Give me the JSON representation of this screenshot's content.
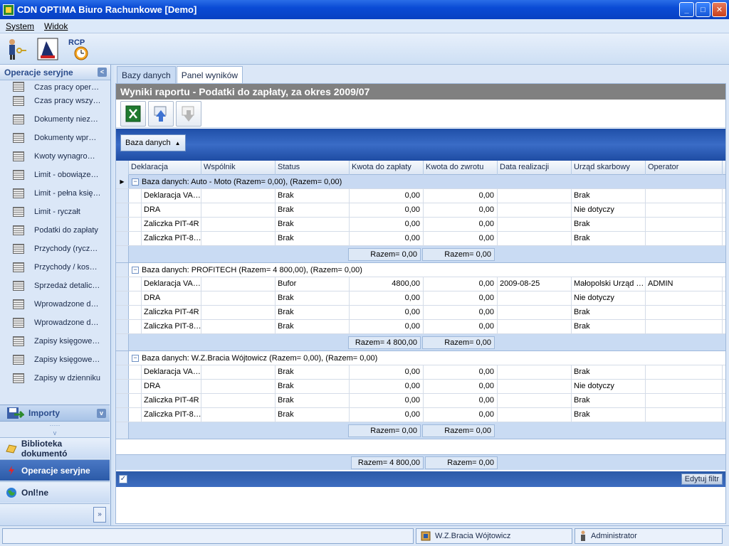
{
  "window": {
    "title": "CDN OPT!MA Biuro Rachunkowe [Demo]"
  },
  "menu": {
    "items": [
      "System",
      "Widok"
    ]
  },
  "toolbar": {
    "rcp_label": "RCP"
  },
  "sidebar": {
    "header": "Operacje seryjne",
    "items": [
      "Czas pracy oper…",
      "Czas pracy wszy…",
      "Dokumenty niez…",
      "Dokumenty wpr…",
      "Kwoty wynagro…",
      "Limit - obowiąze…",
      "Limit - pełna księ…",
      "Limit - ryczałt",
      "Podatki do zapłaty",
      "Przychody (rycz…",
      "Przychody / kos…",
      "Sprzedaż detalic…",
      "Wprowadzone d…",
      "Wprowadzone d…",
      "Zapisy księgowe…",
      "Zapisy księgowe…",
      "Zapisy w dzienniku"
    ],
    "importy": "Importy",
    "nav": [
      "Biblioteka dokumentó",
      "Operacje seryjne",
      "Onl!ne"
    ]
  },
  "tabs": [
    "Bazy danych",
    "Panel wyników"
  ],
  "report": {
    "title": "Wyniki raportu - Podatki do zapłaty, za okres 2009/07",
    "group_chip": "Baza danych",
    "columns": [
      "Deklaracja",
      "Wspólnik",
      "Status",
      "Kwota do zapłaty",
      "Kwota do zwrotu",
      "Data realizacji",
      "Urząd skarbowy",
      "Operator"
    ],
    "groups": [
      {
        "header": "Baza danych: Auto - Moto (Razem=   0,00), (Razem=   0,00)",
        "rows": [
          [
            "Deklaracja VA…",
            "",
            "Brak",
            "0,00",
            "0,00",
            "",
            "Brak",
            ""
          ],
          [
            "DRA",
            "",
            "Brak",
            "0,00",
            "0,00",
            "",
            "Nie dotyczy",
            ""
          ],
          [
            "Zaliczka PIT-4R",
            "",
            "Brak",
            "0,00",
            "0,00",
            "",
            "Brak",
            ""
          ],
          [
            "Zaliczka PIT-8…",
            "",
            "Brak",
            "0,00",
            "0,00",
            "",
            "Brak",
            ""
          ]
        ],
        "sum_zaplaty": "Razem=   0,00",
        "sum_zwrotu": "Razem=   0,00"
      },
      {
        "header": "Baza danych: PROFITECH (Razem=  4 800,00), (Razem=   0,00)",
        "rows": [
          [
            "Deklaracja VA…",
            "",
            "Bufor",
            "4800,00",
            "0,00",
            "2009-08-25",
            "Małopolski Urząd …",
            "ADMIN"
          ],
          [
            "DRA",
            "",
            "Brak",
            "0,00",
            "0,00",
            "",
            "Nie dotyczy",
            ""
          ],
          [
            "Zaliczka PIT-4R",
            "",
            "Brak",
            "0,00",
            "0,00",
            "",
            "Brak",
            ""
          ],
          [
            "Zaliczka PIT-8…",
            "",
            "Brak",
            "0,00",
            "0,00",
            "",
            "Brak",
            ""
          ]
        ],
        "sum_zaplaty": "Razem=  4 800,00",
        "sum_zwrotu": "Razem=   0,00"
      },
      {
        "header": "Baza danych: W.Z.Bracia Wójtowicz (Razem=   0,00), (Razem=   0,00)",
        "rows": [
          [
            "Deklaracja VA…",
            "",
            "Brak",
            "0,00",
            "0,00",
            "",
            "Brak",
            ""
          ],
          [
            "DRA",
            "",
            "Brak",
            "0,00",
            "0,00",
            "",
            "Nie dotyczy",
            ""
          ],
          [
            "Zaliczka PIT-4R",
            "",
            "Brak",
            "0,00",
            "0,00",
            "",
            "Brak",
            ""
          ],
          [
            "Zaliczka PIT-8…",
            "",
            "Brak",
            "0,00",
            "0,00",
            "",
            "Brak",
            ""
          ]
        ],
        "sum_zaplaty": "Razem=   0,00",
        "sum_zwrotu": "Razem=   0,00"
      }
    ],
    "total_zaplaty": "Razem=  4 800,00",
    "total_zwrotu": "Razem=   0,00",
    "edit_filter": "Edytuj filtr"
  },
  "status": {
    "company": "W.Z.Bracia Wójtowicz",
    "user": "Administrator"
  }
}
